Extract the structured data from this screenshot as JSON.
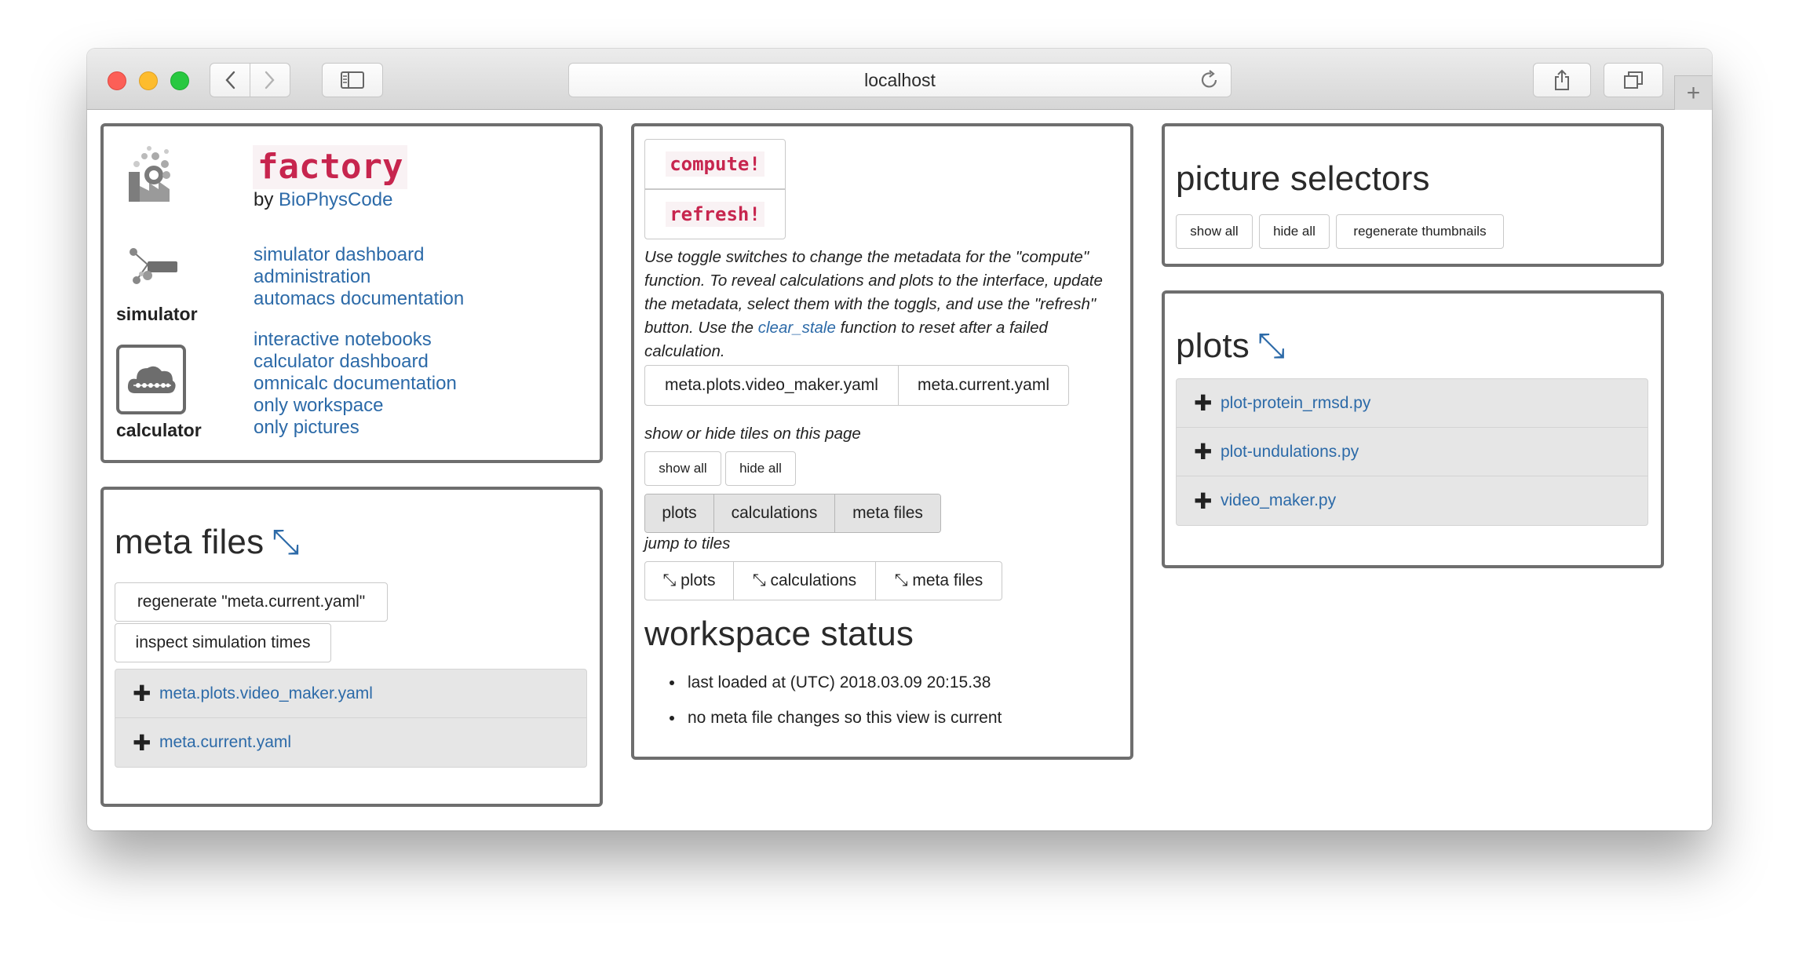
{
  "browser": {
    "url": "localhost"
  },
  "factory": {
    "title": "factory",
    "by_prefix": "by ",
    "by_link": "BioPhysCode",
    "simulator_links": [
      "simulator dashboard",
      "administration",
      "automacs documentation"
    ],
    "calculator_links": [
      "interactive notebooks",
      "calculator dashboard",
      "omnicalc documentation",
      "only workspace",
      "only pictures"
    ],
    "simulator_label": "simulator",
    "calculator_label": "calculator"
  },
  "meta_files": {
    "heading": "meta files",
    "arrow": "⤡",
    "regenerate_label": "regenerate \"meta.current.yaml\"",
    "inspect_label": "inspect simulation times",
    "files": [
      "meta.plots.video_maker.yaml",
      "meta.current.yaml"
    ]
  },
  "compute": {
    "compute_label": "compute!",
    "refresh_label": "refresh!",
    "instructions_before": "Use toggle switches to change the metadata for the \"compute\" function. To reveal calculations and plots to the interface, update the metadata, select them with the toggls, and use the \"refresh\" button. Use the ",
    "instructions_link": "clear_stale",
    "instructions_after": " function to reset after a failed calculation.",
    "meta_toggles": [
      "meta.plots.video_maker.yaml",
      "meta.current.yaml"
    ],
    "show_hide_label": "show or hide tiles on this page",
    "show_all": "show all",
    "hide_all": "hide all",
    "tile_toggles": [
      "plots",
      "calculations",
      "meta files"
    ],
    "jump_label": "jump to tiles",
    "jump_buttons": [
      "⤡ plots",
      "⤡ calculations",
      "⤡ meta files"
    ],
    "status_heading": "workspace status",
    "status_items": [
      "last loaded at (UTC) 2018.03.09 20:15.38",
      "no meta file changes so this view is current"
    ]
  },
  "picture_selectors": {
    "heading": "picture selectors",
    "buttons": [
      "show all",
      "hide all",
      "regenerate thumbnails"
    ]
  },
  "plots": {
    "heading": "plots",
    "arrow": "⤡",
    "items": [
      "plot-protein_rmsd.py",
      "plot-undulations.py",
      "video_maker.py"
    ]
  }
}
